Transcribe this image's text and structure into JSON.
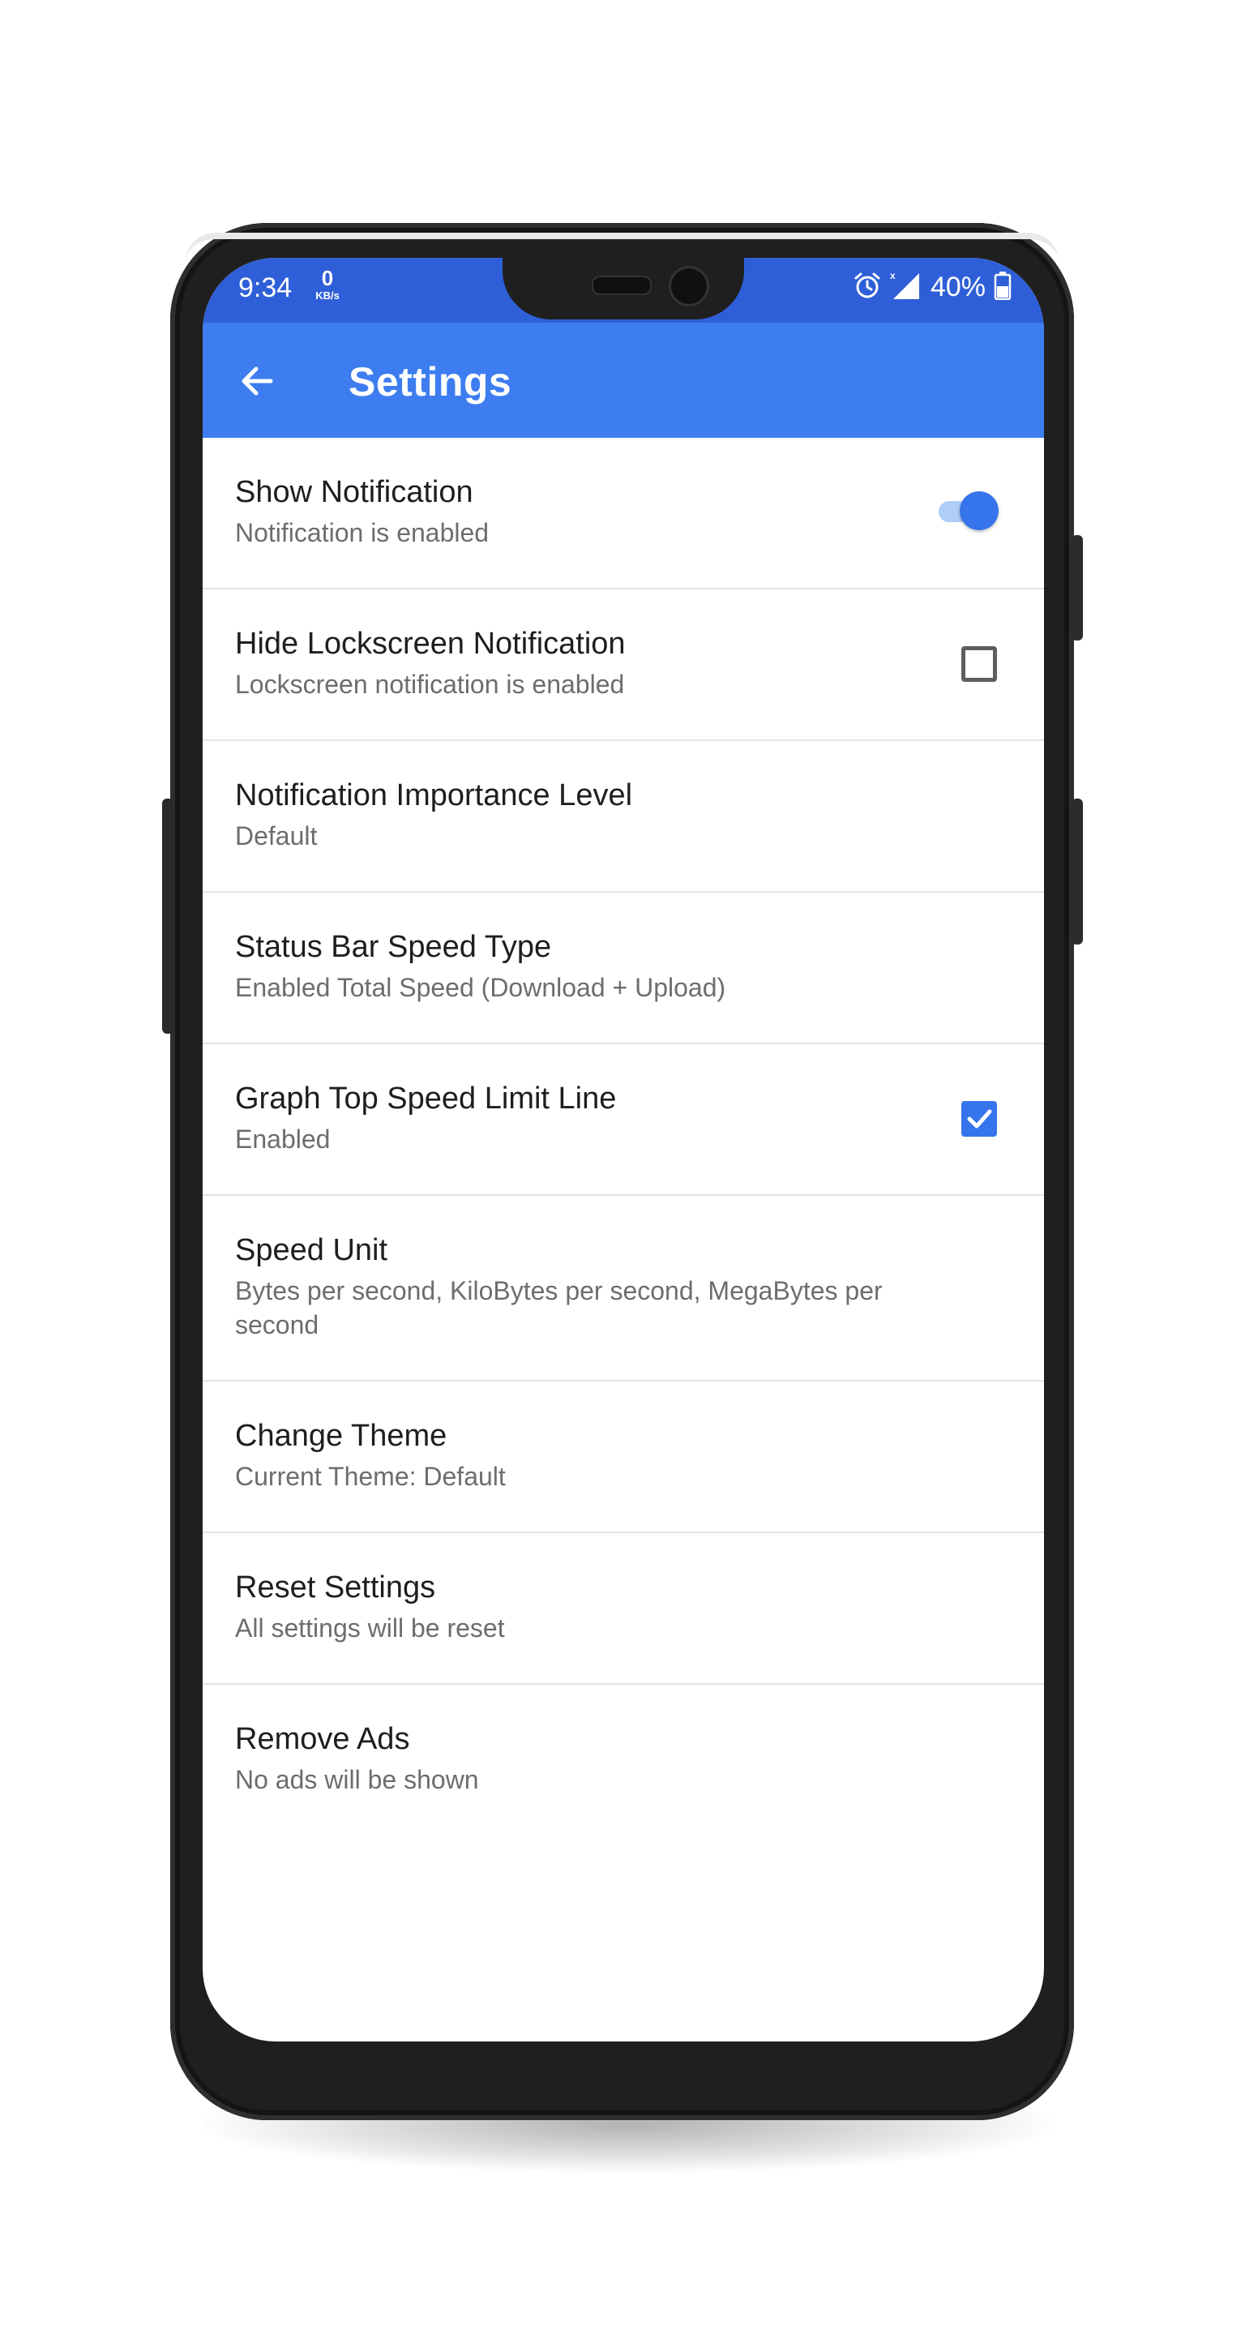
{
  "status_bar": {
    "time": "9:34",
    "speed_value": "0",
    "speed_unit": "KB/s",
    "battery_percent": "40%",
    "icons": [
      "alarm-icon",
      "signal-icon",
      "battery-icon"
    ]
  },
  "app_bar": {
    "title": "Settings",
    "back_icon": "arrow-back-icon"
  },
  "colors": {
    "status_bar": "#2f5fd8",
    "app_bar": "#3d7df0",
    "accent": "#3674ec"
  },
  "settings": [
    {
      "title": "Show Notification",
      "subtitle": "Notification is enabled",
      "control": "toggle",
      "value": true
    },
    {
      "title": "Hide Lockscreen Notification",
      "subtitle": "Lockscreen notification is enabled",
      "control": "checkbox",
      "value": false
    },
    {
      "title": "Notification Importance Level",
      "subtitle": "Default",
      "control": "none"
    },
    {
      "title": "Status Bar Speed Type",
      "subtitle": "Enabled Total Speed (Download + Upload)",
      "control": "none"
    },
    {
      "title": "Graph Top Speed Limit Line",
      "subtitle": "Enabled",
      "control": "checkbox",
      "value": true
    },
    {
      "title": "Speed Unit",
      "subtitle": "Bytes per second, KiloBytes per second, MegaBytes per second",
      "control": "none"
    },
    {
      "title": "Change Theme",
      "subtitle": "Current Theme: Default",
      "control": "none"
    },
    {
      "title": "Reset Settings",
      "subtitle": "All settings will be reset",
      "control": "none"
    },
    {
      "title": "Remove Ads",
      "subtitle": "No ads will be shown",
      "control": "none"
    }
  ]
}
